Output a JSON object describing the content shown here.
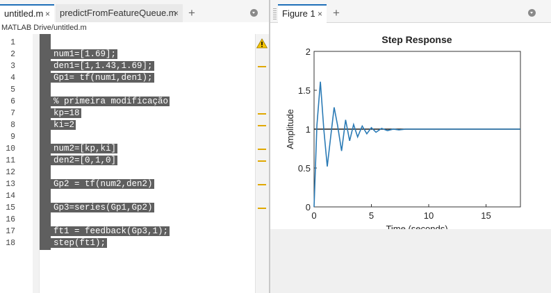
{
  "editor": {
    "tabs": [
      {
        "label": "untitled.m",
        "close": "×",
        "active": true
      },
      {
        "label": "predictFromFeatureQueue.m",
        "close": "×",
        "active": false
      }
    ],
    "add_tab": "+",
    "path": "MATLAB Drive/untitled.m",
    "lines": [
      {
        "num": "1",
        "code": ""
      },
      {
        "num": "2",
        "code": "num1=[1.69];"
      },
      {
        "num": "3",
        "code": "den1=[1,1.43,1.69];"
      },
      {
        "num": "4",
        "code": "Gp1= tf(num1,den1);"
      },
      {
        "num": "5",
        "code": ""
      },
      {
        "num": "6",
        "code": "% primeira modificação"
      },
      {
        "num": "7",
        "code": "kp=18"
      },
      {
        "num": "8",
        "code": "ki=2"
      },
      {
        "num": "9",
        "code": ""
      },
      {
        "num": "10",
        "code": "num2=[kp,ki]"
      },
      {
        "num": "11",
        "code": "den2=[0,1,0]"
      },
      {
        "num": "12",
        "code": ""
      },
      {
        "num": "13",
        "code": "Gp2 = tf(num2,den2)"
      },
      {
        "num": "14",
        "code": ""
      },
      {
        "num": "15",
        "code": "Gp3=series(Gp1,Gp2)"
      },
      {
        "num": "16",
        "code": ""
      },
      {
        "num": "17",
        "code": "ft1 = feedback(Gp3,1);"
      },
      {
        "num": "18",
        "code": "step(ft1);"
      }
    ],
    "warning_icon": "warning-triangle-icon",
    "warning_marker_lines": [
      3,
      7,
      8,
      10,
      11,
      13,
      15
    ]
  },
  "figure": {
    "tabs": [
      {
        "label": "Figure 1",
        "close": "×",
        "active": true
      }
    ],
    "add_tab": "+"
  },
  "colors": {
    "accent": "#1f6fb8",
    "line": "#2a7ab5",
    "warning": "#e0a800",
    "selection": "#5f5f5f"
  },
  "chart_data": {
    "type": "line",
    "title": "Step Response",
    "xlabel": "Time (seconds)",
    "ylabel": "Amplitude",
    "xlim": [
      0,
      18
    ],
    "ylim": [
      0,
      2
    ],
    "xticks": [
      "0",
      "5",
      "10",
      "15"
    ],
    "yticks": [
      "0",
      "0.5",
      "1",
      "1.5",
      "2"
    ],
    "grid": false,
    "series": [
      {
        "x": [
          0,
          0.25,
          0.55,
          0.85,
          1.15,
          1.45,
          1.75,
          2.05,
          2.4,
          2.75,
          3.1,
          3.45,
          3.8,
          4.2,
          4.6,
          5.0,
          5.4,
          5.9,
          6.4,
          6.9,
          7.4,
          8.0,
          9.0,
          10.0,
          12.0,
          14.0,
          16.0,
          18.0
        ],
        "y": [
          0,
          1.05,
          1.61,
          1.0,
          0.52,
          0.9,
          1.28,
          1.05,
          0.72,
          1.12,
          0.85,
          1.06,
          0.9,
          1.04,
          0.94,
          1.02,
          0.96,
          1.01,
          0.98,
          1.0,
          0.99,
          1.0,
          1.0,
          1.0,
          1.0,
          1.0,
          1.0,
          1.0
        ]
      }
    ],
    "reference_line": 1
  }
}
